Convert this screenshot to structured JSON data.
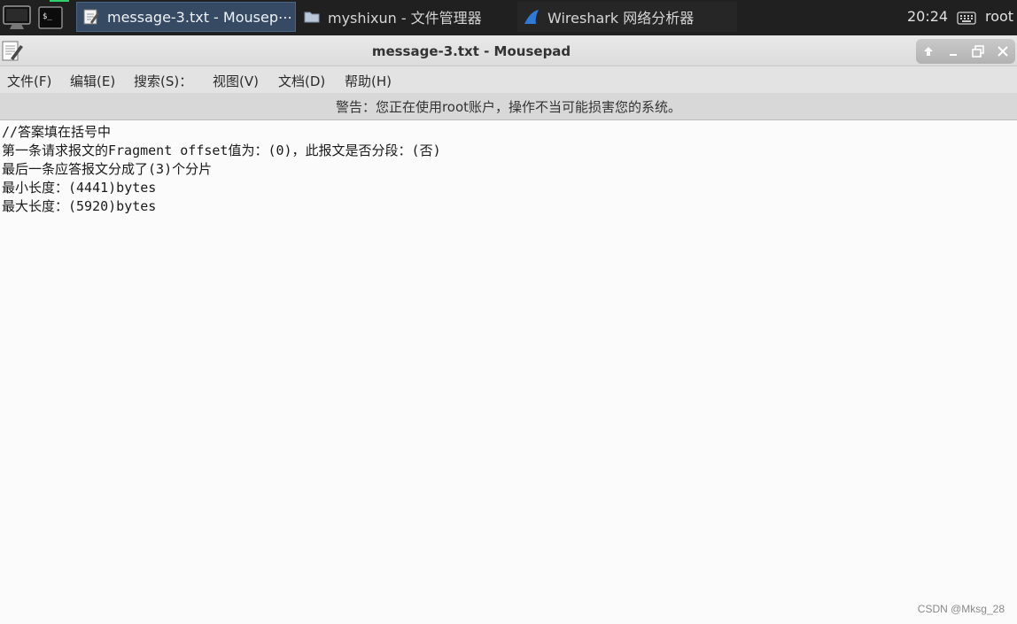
{
  "taskbar": {
    "tasks": [
      {
        "label": "message-3.txt - Mousep⋯",
        "active": true
      },
      {
        "label": "myshixun - 文件管理器",
        "active": false
      },
      {
        "label": "Wireshark 网络分析器",
        "active": false
      }
    ],
    "clock": "20:24",
    "user": "root"
  },
  "window": {
    "title": "message-3.txt - Mousepad"
  },
  "menu": [
    "文件(F)",
    "编辑(E)",
    "搜索(S)：",
    "视图(V)",
    "文档(D)",
    "帮助(H)"
  ],
  "warning": "警告：您正在使用root账户，操作不当可能损害您的系统。",
  "document": {
    "lines": [
      "//答案填在括号中",
      "第一条请求报文的Fragment offset值为：(0)，此报文是否分段：(否)",
      "最后一条应答报文分成了(3)个分片",
      "最小长度：(4441)bytes",
      "最大长度：(5920)bytes"
    ]
  },
  "watermark": "CSDN @Mksg_28",
  "colors": {
    "panel_bg": "#202020",
    "active_task_bg": "#364a63",
    "editor_bg": "#fbfbfb"
  }
}
